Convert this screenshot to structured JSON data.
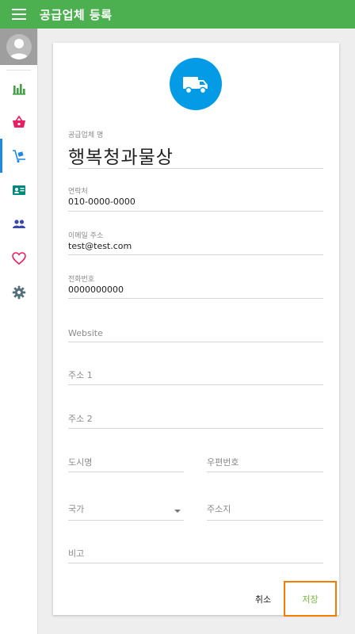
{
  "header": {
    "title": "공급업체 등록",
    "menu_icon": "hamburger-menu-icon",
    "background_color": "#4caf50"
  },
  "sidebar": {
    "avatar_icon": "user-avatar-icon",
    "items": [
      {
        "icon": "bar-chart-icon",
        "color": "#43a047",
        "active": false
      },
      {
        "icon": "shopping-basket-icon",
        "color": "#e91e63",
        "active": false
      },
      {
        "icon": "hand-truck-icon",
        "color": "#1e88e5",
        "active": true
      },
      {
        "icon": "id-card-icon",
        "color": "#00897b",
        "active": false
      },
      {
        "icon": "people-icon",
        "color": "#3949ab",
        "active": false
      },
      {
        "icon": "heart-icon",
        "color": "#e91e63",
        "active": false
      },
      {
        "icon": "gear-icon",
        "color": "#546e7a",
        "active": false
      }
    ]
  },
  "form": {
    "header_icon": "truck-icon",
    "header_icon_color": "#039be5",
    "name": {
      "label": "공급업체 명",
      "value": "행복청과물상"
    },
    "contact": {
      "label": "연락처",
      "value": "010-0000-0000"
    },
    "email": {
      "label": "이메일 주소",
      "value": "test@test.com"
    },
    "phone": {
      "label": "전화번호",
      "value": "0000000000"
    },
    "website": {
      "placeholder": "Website"
    },
    "address1": {
      "placeholder": "주소 1"
    },
    "address2": {
      "placeholder": "주소 2"
    },
    "city": {
      "placeholder": "도시명"
    },
    "zip": {
      "placeholder": "우편번호"
    },
    "country": {
      "placeholder": "국가"
    },
    "state": {
      "placeholder": "주소지"
    },
    "note": {
      "placeholder": "비고"
    }
  },
  "actions": {
    "cancel_label": "취소",
    "save_label": "저장",
    "save_color": "#7cb342",
    "save_highlight_color": "#f57c00"
  }
}
